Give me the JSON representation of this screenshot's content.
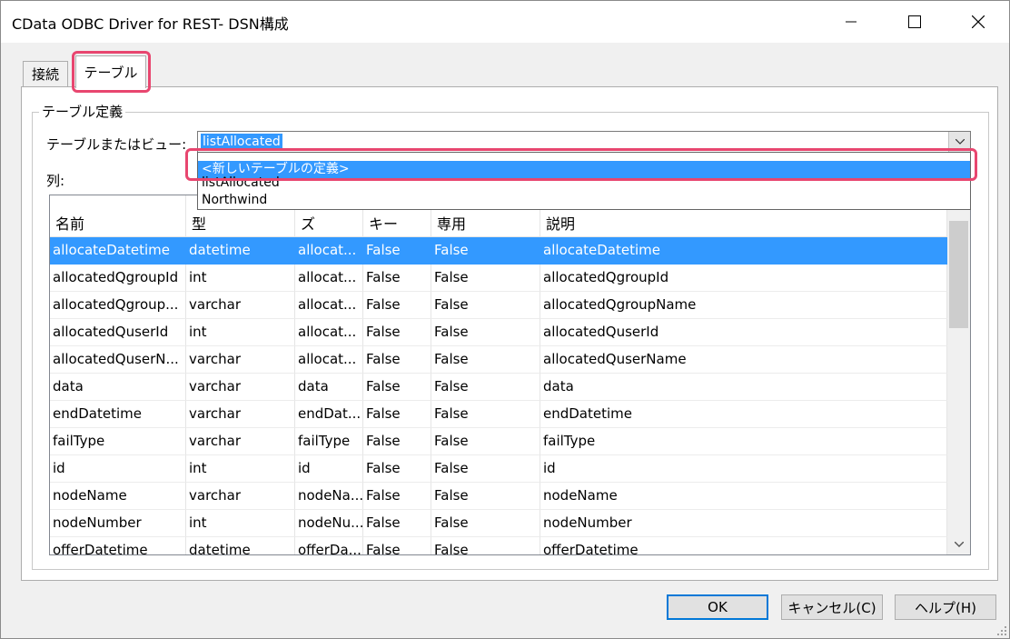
{
  "window": {
    "title": "CData ODBC Driver for REST- DSN構成"
  },
  "tabs": [
    {
      "label": "接続",
      "active": false
    },
    {
      "label": "テーブル",
      "active": true
    }
  ],
  "group": {
    "legend": "テーブル定義"
  },
  "table_select": {
    "label": "テーブルまたはビュー:",
    "selected": "listAllocated",
    "options": [
      "<新しいテーブルの定義>",
      "listAllocated",
      "Northwind"
    ],
    "highlighted_index": 0
  },
  "columns_label": "列:",
  "grid": {
    "headers": [
      "名前",
      "型",
      "サイズ",
      "キー",
      "読み取り専用",
      "説明"
    ],
    "header_display": [
      "名前",
      "型",
      "ズ",
      "キー",
      "専用",
      "説明"
    ],
    "rows": [
      [
        "allocateDatetime",
        "datetime",
        "allocat...",
        "False",
        "False",
        "allocateDatetime"
      ],
      [
        "allocatedQgroupId",
        "int",
        "allocat...",
        "False",
        "False",
        "allocatedQgroupId"
      ],
      [
        "allocatedQgroup...",
        "varchar",
        "allocat...",
        "False",
        "False",
        "allocatedQgroupName"
      ],
      [
        "allocatedQuserId",
        "int",
        "allocat...",
        "False",
        "False",
        "allocatedQuserId"
      ],
      [
        "allocatedQuserN...",
        "varchar",
        "allocat...",
        "False",
        "False",
        "allocatedQuserName"
      ],
      [
        "data",
        "varchar",
        "data",
        "False",
        "False",
        "data"
      ],
      [
        "endDatetime",
        "varchar",
        "endDat...",
        "False",
        "False",
        "endDatetime"
      ],
      [
        "failType",
        "varchar",
        "failType",
        "False",
        "False",
        "failType"
      ],
      [
        "id",
        "int",
        "id",
        "False",
        "False",
        "id"
      ],
      [
        "nodeName",
        "varchar",
        "nodeNa...",
        "False",
        "False",
        "nodeName"
      ],
      [
        "nodeNumber",
        "int",
        "nodeNu...",
        "False",
        "False",
        "nodeNumber"
      ],
      [
        "offerDatetime",
        "datetime",
        "offerDa...",
        "False",
        "False",
        "offerDatetime"
      ]
    ],
    "selected_row": 0
  },
  "buttons": {
    "ok": "OK",
    "cancel": "キャンセル(C)",
    "help": "ヘルプ(H)"
  },
  "colors": {
    "selection": "#3399ff",
    "annotation": "#e8466f",
    "default_button_border": "#0078d7"
  }
}
